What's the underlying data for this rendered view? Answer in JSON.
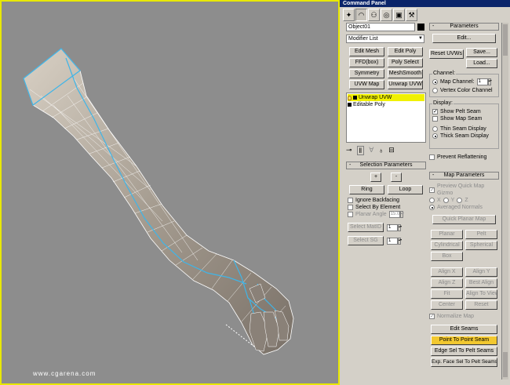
{
  "panel_title": "Command Panel",
  "tabs": [
    "create-icon",
    "modify-icon",
    "hierarchy-icon",
    "motion-icon",
    "display-icon",
    "utilities-icon"
  ],
  "object_name": "Object01",
  "modifier_list": "Modifier List",
  "modifier_buttons": [
    "Edit Mesh",
    "Edit Poly",
    "FFD(box)",
    "Poly Select",
    "Symmetry",
    "MeshSmooth",
    "UVW Map",
    "Unwrap UVW"
  ],
  "stack": [
    {
      "label": "Unwrap UVW",
      "selected": true
    },
    {
      "label": "Editable Poly",
      "selected": false
    }
  ],
  "selection": {
    "title": "Selection Parameters",
    "plus": "+",
    "minus": "-",
    "ring": "Ring",
    "loop": "Loop",
    "ignore_backfacing": "Ignore Backfacing",
    "select_by_element": "Select By Element",
    "planar_angle": "Planar Angle",
    "planar_value": "15.0",
    "select_matid": "Select MatID",
    "select_sg": "Select SG",
    "matid_value": "1",
    "sg_value": "1"
  },
  "parameters": {
    "title": "Parameters",
    "edit": "Edit...",
    "reset_uvws": "Reset UVWs",
    "save": "Save...",
    "load": "Load...",
    "channel_label": "Channel:",
    "map_channel": "Map Channel:",
    "map_channel_value": "1",
    "vertex_color_channel": "Vertex Color Channel",
    "display_label": "Display:",
    "show_pelt_seam": "Show Pelt Seam",
    "show_map_seam": "Show Map Seam",
    "thin_seam": "Thin Seam Display",
    "thick_seam": "Thick Seam Display",
    "prevent_reflattening": "Prevent Reflattening"
  },
  "map_params": {
    "title": "Map Parameters",
    "preview_gizmo": "Preview Quick Map Gizmo",
    "x": "X",
    "y": "Y",
    "z": "Z",
    "averaged_normals": "Averaged Normals",
    "quick_planar_map": "Quick Planar Map",
    "planar": "Planar",
    "pelt": "Pelt",
    "cylindrical": "Cylindrical",
    "spherical": "Spherical",
    "box": "Box",
    "align_x": "Align X",
    "align_y": "Align Y",
    "align_z": "Align Z",
    "best_align": "Best Align",
    "fit": "Fit",
    "align_to_view": "Align To View",
    "center": "Center",
    "reset": "Reset",
    "normalize_map": "Normalize Map",
    "edit_seams": "Edit Seams",
    "point_to_point_seam": "Point To Point Seam",
    "edge_sel_to_pelt": "Edge Sel To Pelt Seams",
    "exp_face_sel": "Exp. Face Sel To Pelt Seams"
  },
  "watermark": "www.cgarena.com",
  "colors": {
    "viewport_border": "#e8e800",
    "selected_stack": "#f0f000",
    "highlight_button": "#f2c830",
    "seam_line": "#3fb5e8"
  }
}
